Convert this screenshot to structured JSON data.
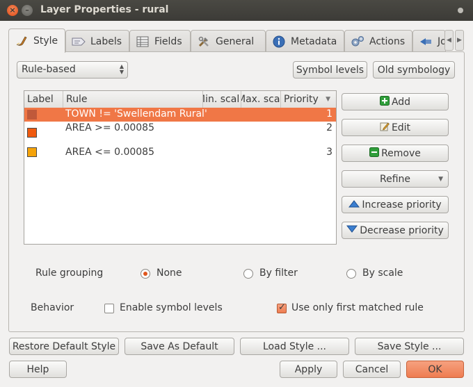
{
  "window": {
    "title": "Layer Properties - rural"
  },
  "tabs": [
    {
      "label": "Style",
      "icon": "paintbrush-icon",
      "active": true
    },
    {
      "label": "Labels",
      "icon": "label-tag-icon"
    },
    {
      "label": "Fields",
      "icon": "table-grid-icon"
    },
    {
      "label": "General",
      "icon": "tools-icon"
    },
    {
      "label": "Metadata",
      "icon": "info-icon"
    },
    {
      "label": "Actions",
      "icon": "gears-icon"
    },
    {
      "label": "Joi",
      "icon": "join-icon"
    }
  ],
  "style": {
    "renderer_select": "Rule-based",
    "symbol_levels_button": "Symbol levels",
    "old_symbology_button": "Old symbology"
  },
  "rules_table": {
    "headers": [
      "Label",
      "Rule",
      "Min. scal",
      "Max. sca",
      "Priority"
    ],
    "header_display": {
      "min_scale": " /in. scal",
      "max_scale": "lax. sca"
    },
    "rows": [
      {
        "rule": "TOWN != 'Swellendam Rural'",
        "priority": "1",
        "color": "#c0593a",
        "selected": true
      },
      {
        "rule": "AREA >= 0.00085",
        "priority": "2",
        "color": "#f05a0f"
      },
      {
        "rule": "AREA <= 0.00085",
        "priority": "3",
        "color": "#f5a30a"
      }
    ]
  },
  "rule_buttons": {
    "add": "Add",
    "edit": "Edit",
    "remove": "Remove",
    "refine": "Refine",
    "increase_priority": "Increase priority",
    "decrease_priority": "Decrease priority"
  },
  "grouping": {
    "label": "Rule grouping",
    "none": "None",
    "by_filter": "By filter",
    "by_scale": "By scale",
    "selected": "None"
  },
  "behavior": {
    "label": "Behavior",
    "enable_symbol_levels": "Enable symbol levels",
    "enable_symbol_levels_checked": false,
    "first_matched_rule": "Use only first matched rule",
    "first_matched_rule_checked": true
  },
  "footer": {
    "restore_default": "Restore Default Style",
    "save_as_default": "Save As Default",
    "load_style": "Load Style ...",
    "save_style": "Save Style ...",
    "help": "Help",
    "apply": "Apply",
    "cancel": "Cancel",
    "ok": "OK"
  },
  "colors": {
    "accent": "#f07746",
    "ok_button": "#ee7c51",
    "titlebar": "#3c3b37"
  }
}
